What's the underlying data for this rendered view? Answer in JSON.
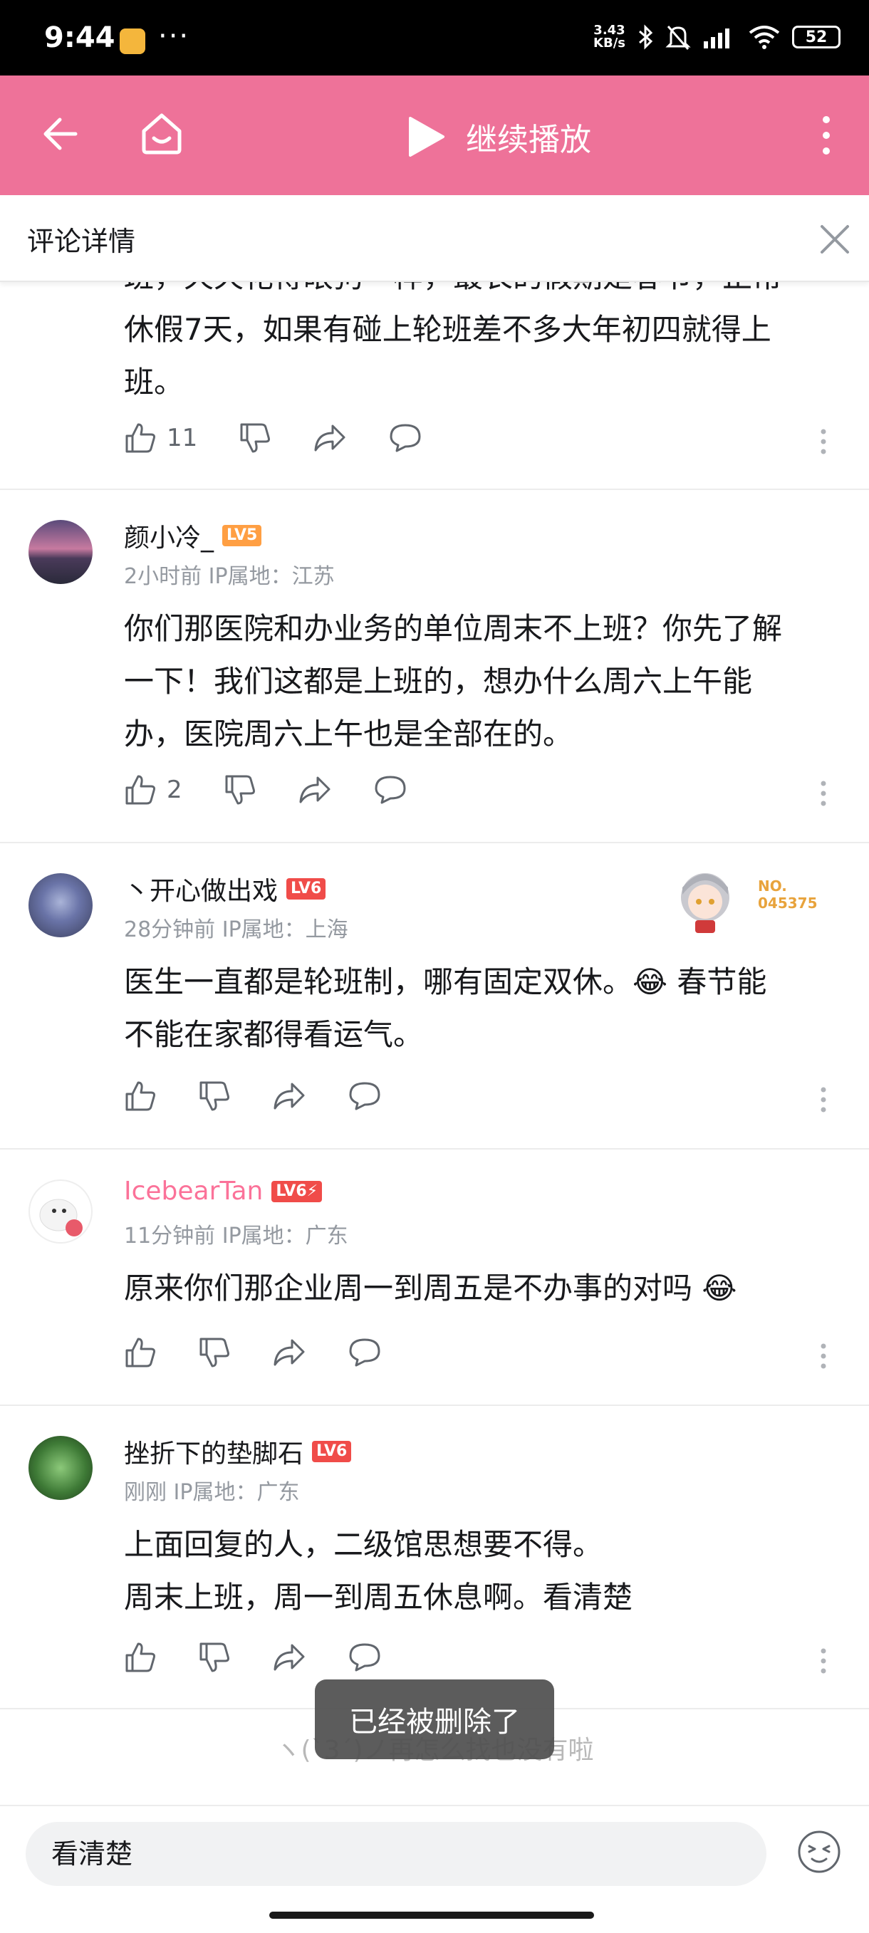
{
  "status_bar": {
    "time": "9:44",
    "dots": "···",
    "speed_top": "3.43",
    "speed_bottom": "KB/s",
    "battery": "52"
  },
  "top_bar": {
    "play_label": "继续播放"
  },
  "sub_header": {
    "title": "评论详情"
  },
  "partial_comment": {
    "text_line1": "班，天天花得眼狗一样，最长的假期是春节，正常",
    "text_line2": "休假7天，如果有碰上轮班差不多大年初四就得上",
    "text_line3": "班。",
    "likes": "11"
  },
  "comments": [
    {
      "username": "颜小冷_",
      "level": "LV5",
      "level_color": "#ff9f43",
      "time": "2小时前",
      "ip": "IP属地：江苏",
      "lines": [
        "你们那医院和办业务的单位周末不上班？你先了解",
        "一下！我们这都是上班的，想办什么周六上午能",
        "办，医院周六上午也是全部在的。"
      ],
      "likes": "2"
    },
    {
      "username": "丶开心做出戏",
      "level": "LV6",
      "level_color": "#f04c49",
      "time": "28分钟前",
      "ip": "IP属地：上海",
      "lines": [
        "医生一直都是轮班制，哪有固定双休。😂 春节能",
        "不能在家都得看运气。"
      ],
      "likes": "",
      "pendant_no": "NO.",
      "pendant_num": "045375"
    },
    {
      "username": "IcebearTan",
      "level": "LV6⚡",
      "level_color": "#f04c49",
      "name_color": "#fb7299",
      "time": "11分钟前",
      "ip": "IP属地：广东",
      "lines": [
        "原来你们那企业周一到周五是不办事的对吗 😂"
      ],
      "likes": ""
    },
    {
      "username": "挫折下的垫脚石",
      "level": "LV6",
      "level_color": "#f04c49",
      "time": "刚刚",
      "ip": "IP属地：广东",
      "lines": [
        "上面回复的人，二级馆思想要不得。",
        "周末上班，周一到周五休息啊。看清楚"
      ],
      "likes": ""
    }
  ],
  "footer": {
    "end_text": "ヽ(ˋ3ˊ)ノ再怎么找也没有啦"
  },
  "toast": {
    "text": "已经被删除了"
  },
  "input": {
    "value": "看清楚"
  }
}
